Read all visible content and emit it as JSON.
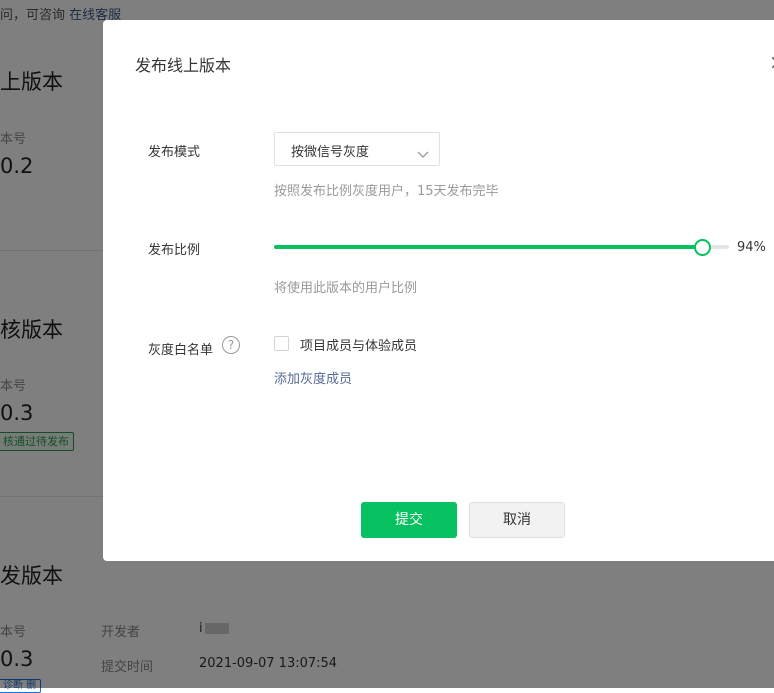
{
  "background": {
    "notice_text": "问，可咨询",
    "notice_link": "在线客服",
    "sections": [
      {
        "title": "上版本",
        "version_label": "本号",
        "version": "0.2"
      },
      {
        "title": "核版本",
        "version_label": "本号",
        "version": "0.3",
        "badge": "核通过待发布"
      },
      {
        "title": "发版本",
        "version_label": "本号",
        "version": "0.3",
        "badge": "诊断  删"
      }
    ],
    "dev_meta": {
      "developer_label": "开发者",
      "developer_value": "i",
      "submit_time_label": "提交时间",
      "submit_time_value": "2021-09-07 13:07:54"
    }
  },
  "dialog": {
    "title": "发布线上版本",
    "close_icon": "×",
    "mode": {
      "label": "发布模式",
      "selected": "按微信号灰度",
      "hint": "按照发布比例灰度用户，15天发布完毕"
    },
    "ratio": {
      "label": "发布比例",
      "percent": 94,
      "percent_text": "94%",
      "hint": "将使用此版本的用户比例"
    },
    "whitelist": {
      "label": "灰度白名单",
      "help_icon": "?",
      "checkbox_label": "项目成员与体验成员",
      "checked": false,
      "add_link": "添加灰度成员"
    },
    "buttons": {
      "submit": "提交",
      "cancel": "取消"
    }
  },
  "colors": {
    "primary": "#07c160",
    "link": "#576b95",
    "overlay": "rgba(0,0,0,0.5)"
  }
}
